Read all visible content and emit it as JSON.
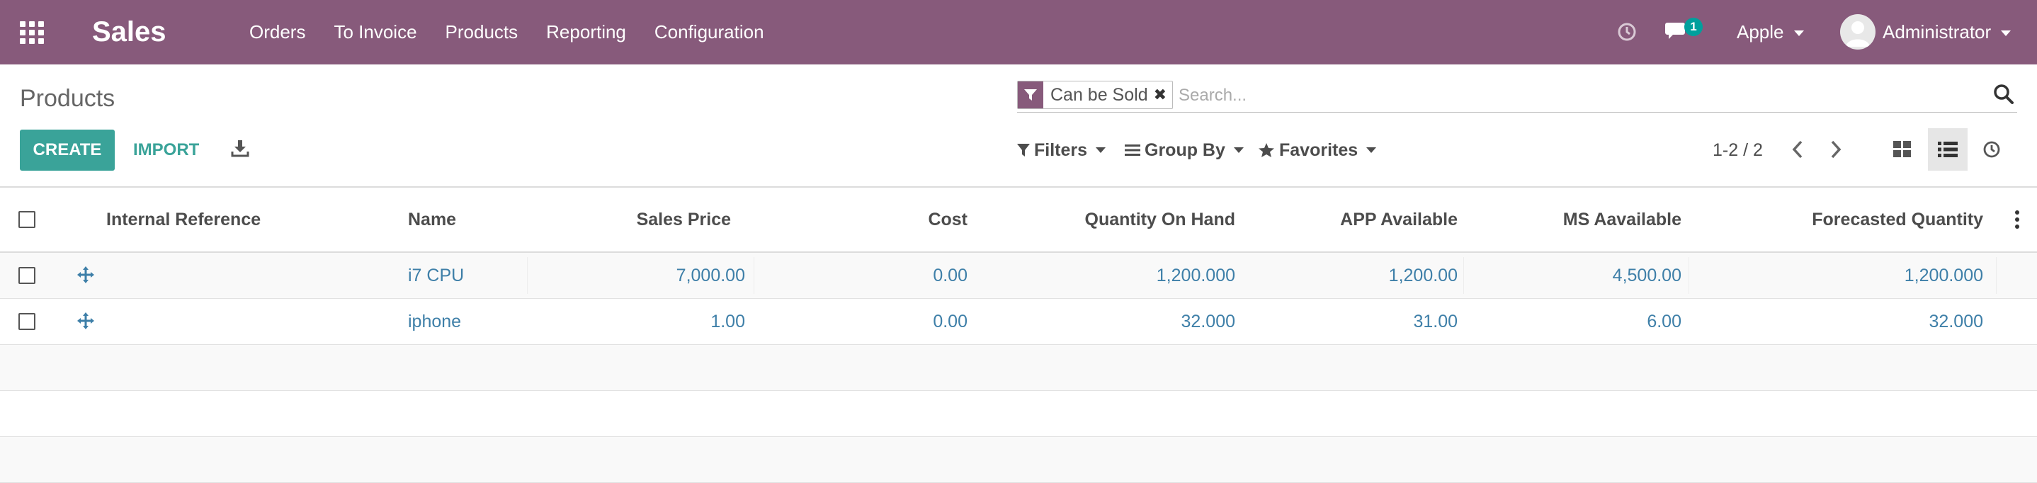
{
  "navbar": {
    "app_name": "Sales",
    "menu": [
      "Orders",
      "To Invoice",
      "Products",
      "Reporting",
      "Configuration"
    ],
    "messages_count": "1",
    "company": "Apple",
    "user": "Administrator",
    "bg_color": "#875a7b"
  },
  "page": {
    "title": "Products"
  },
  "search": {
    "facet_label": "Can be Sold",
    "placeholder": "Search..."
  },
  "buttons": {
    "create": "CREATE",
    "import": "IMPORT"
  },
  "filters": {
    "filters_label": "Filters",
    "group_by_label": "Group By",
    "favorites_label": "Favorites"
  },
  "pager": {
    "value": "1-2 / 2"
  },
  "table": {
    "columns": [
      "Internal Reference",
      "Name",
      "Sales Price",
      "Cost",
      "Quantity On Hand",
      "APP Available",
      "MS Aavailable",
      "Forecasted Quantity"
    ],
    "rows": [
      {
        "internal_reference": "",
        "name": "i7 CPU",
        "sales_price": "7,000.00",
        "cost": "0.00",
        "qty_on_hand": "1,200.000",
        "app_available": "1,200.00",
        "ms_available": "4,500.00",
        "forecasted": "1,200.000"
      },
      {
        "internal_reference": "",
        "name": "iphone",
        "sales_price": "1.00",
        "cost": "0.00",
        "qty_on_hand": "32.000",
        "app_available": "31.00",
        "ms_available": "6.00",
        "forecasted": "32.000"
      }
    ]
  },
  "colors": {
    "primary": "#3aa399",
    "link": "#3e7fa8",
    "badge": "#00a09d"
  }
}
